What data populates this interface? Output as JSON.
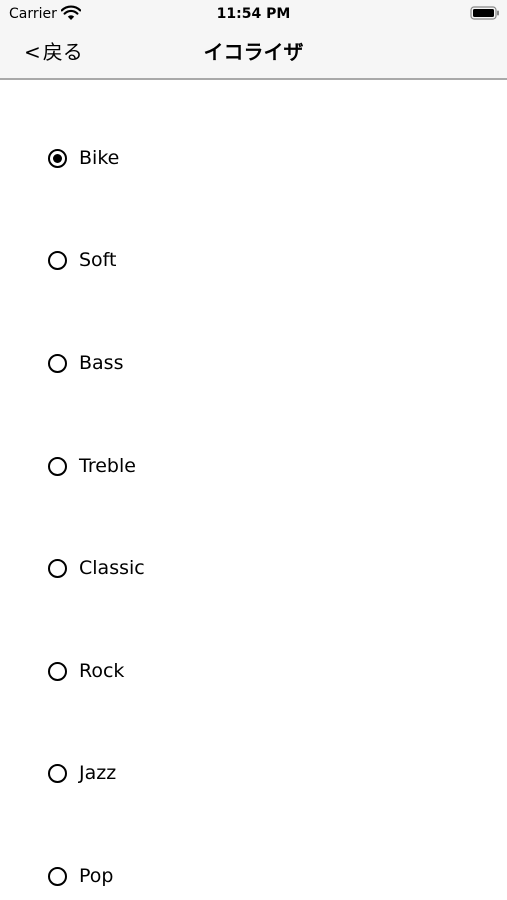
{
  "status_bar": {
    "carrier": "Carrier",
    "time": "11:54 PM",
    "wifi_icon": "wifi-icon",
    "battery_icon": "battery-icon"
  },
  "nav": {
    "back_chevron": "<",
    "back_label": "戻る",
    "title": "イコライザ"
  },
  "equalizer": {
    "selected": "Bike",
    "options": [
      {
        "label": "Bike",
        "checked": true
      },
      {
        "label": "Soft",
        "checked": false
      },
      {
        "label": "Bass",
        "checked": false
      },
      {
        "label": "Treble",
        "checked": false
      },
      {
        "label": "Classic",
        "checked": false
      },
      {
        "label": "Rock",
        "checked": false
      },
      {
        "label": "Jazz",
        "checked": false
      },
      {
        "label": "Pop",
        "checked": false
      }
    ]
  }
}
